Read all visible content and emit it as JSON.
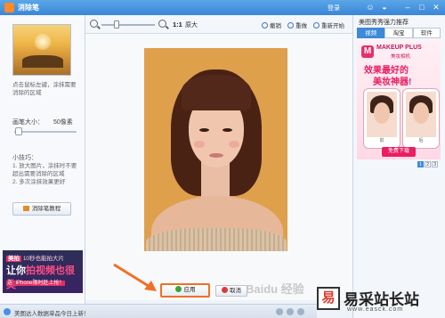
{
  "window": {
    "title": "消除笔",
    "login": "登录"
  },
  "left_panel": {
    "hint": "点击鼠标左键，涂抹需要消除的区域",
    "brush_size_label": "画笔大小：",
    "brush_size_value": "50像素",
    "brush_size_fraction": 0.05,
    "tips_title": "小技巧：",
    "tips": "1. 放大图片，涂抹时不要超出需要消除的区域\n2. 多次涂抹效果更好",
    "eraser_tutorial_button": "消除笔教程",
    "ad": {
      "line1_badge": "美拍",
      "line1": "10秒也能拍大片",
      "line2_prefix": "让你",
      "line2_highlight": "拍视频也很美",
      "line3_badge": "送",
      "line3": "iPhone限时赶上抢！"
    }
  },
  "toolbar": {
    "zoom_level_fraction": 0.25,
    "zoom_11": "1:1",
    "original_size": "原大",
    "undo": "撤销",
    "redo": "重做",
    "reset": "重新开始"
  },
  "canvas": {
    "watermark": "Baidu 经验",
    "apply_button": "应用",
    "cancel_button": "取消"
  },
  "right_panel": {
    "title": "美图秀秀强力推荐",
    "tabs": [
      {
        "label": "视频",
        "active": true
      },
      {
        "label": "淘宝",
        "active": false
      },
      {
        "label": "软件",
        "active": false
      }
    ],
    "ad": {
      "logo_letter": "M",
      "brand": "MAKEUP PLUS",
      "brand_sub": "美妆相机",
      "headline1": "效果最好的",
      "headline2": "美妆神器!",
      "phone_a_label": "前",
      "phone_b_label": "后",
      "download_button": "免费下载"
    },
    "pager": [
      "1",
      "2",
      "3"
    ],
    "pager_active": 0
  },
  "site_watermark": {
    "box_char": "易",
    "name": "易采站长站",
    "url": "www.easck.com"
  },
  "statusbar": {
    "text": "美图达人数据单品今日上新！"
  },
  "colors": {
    "titlebar": "#3a86d6",
    "accent_orange": "#f07024",
    "ad_pink": "#e91e63",
    "photo_background": "#dfa04c"
  }
}
